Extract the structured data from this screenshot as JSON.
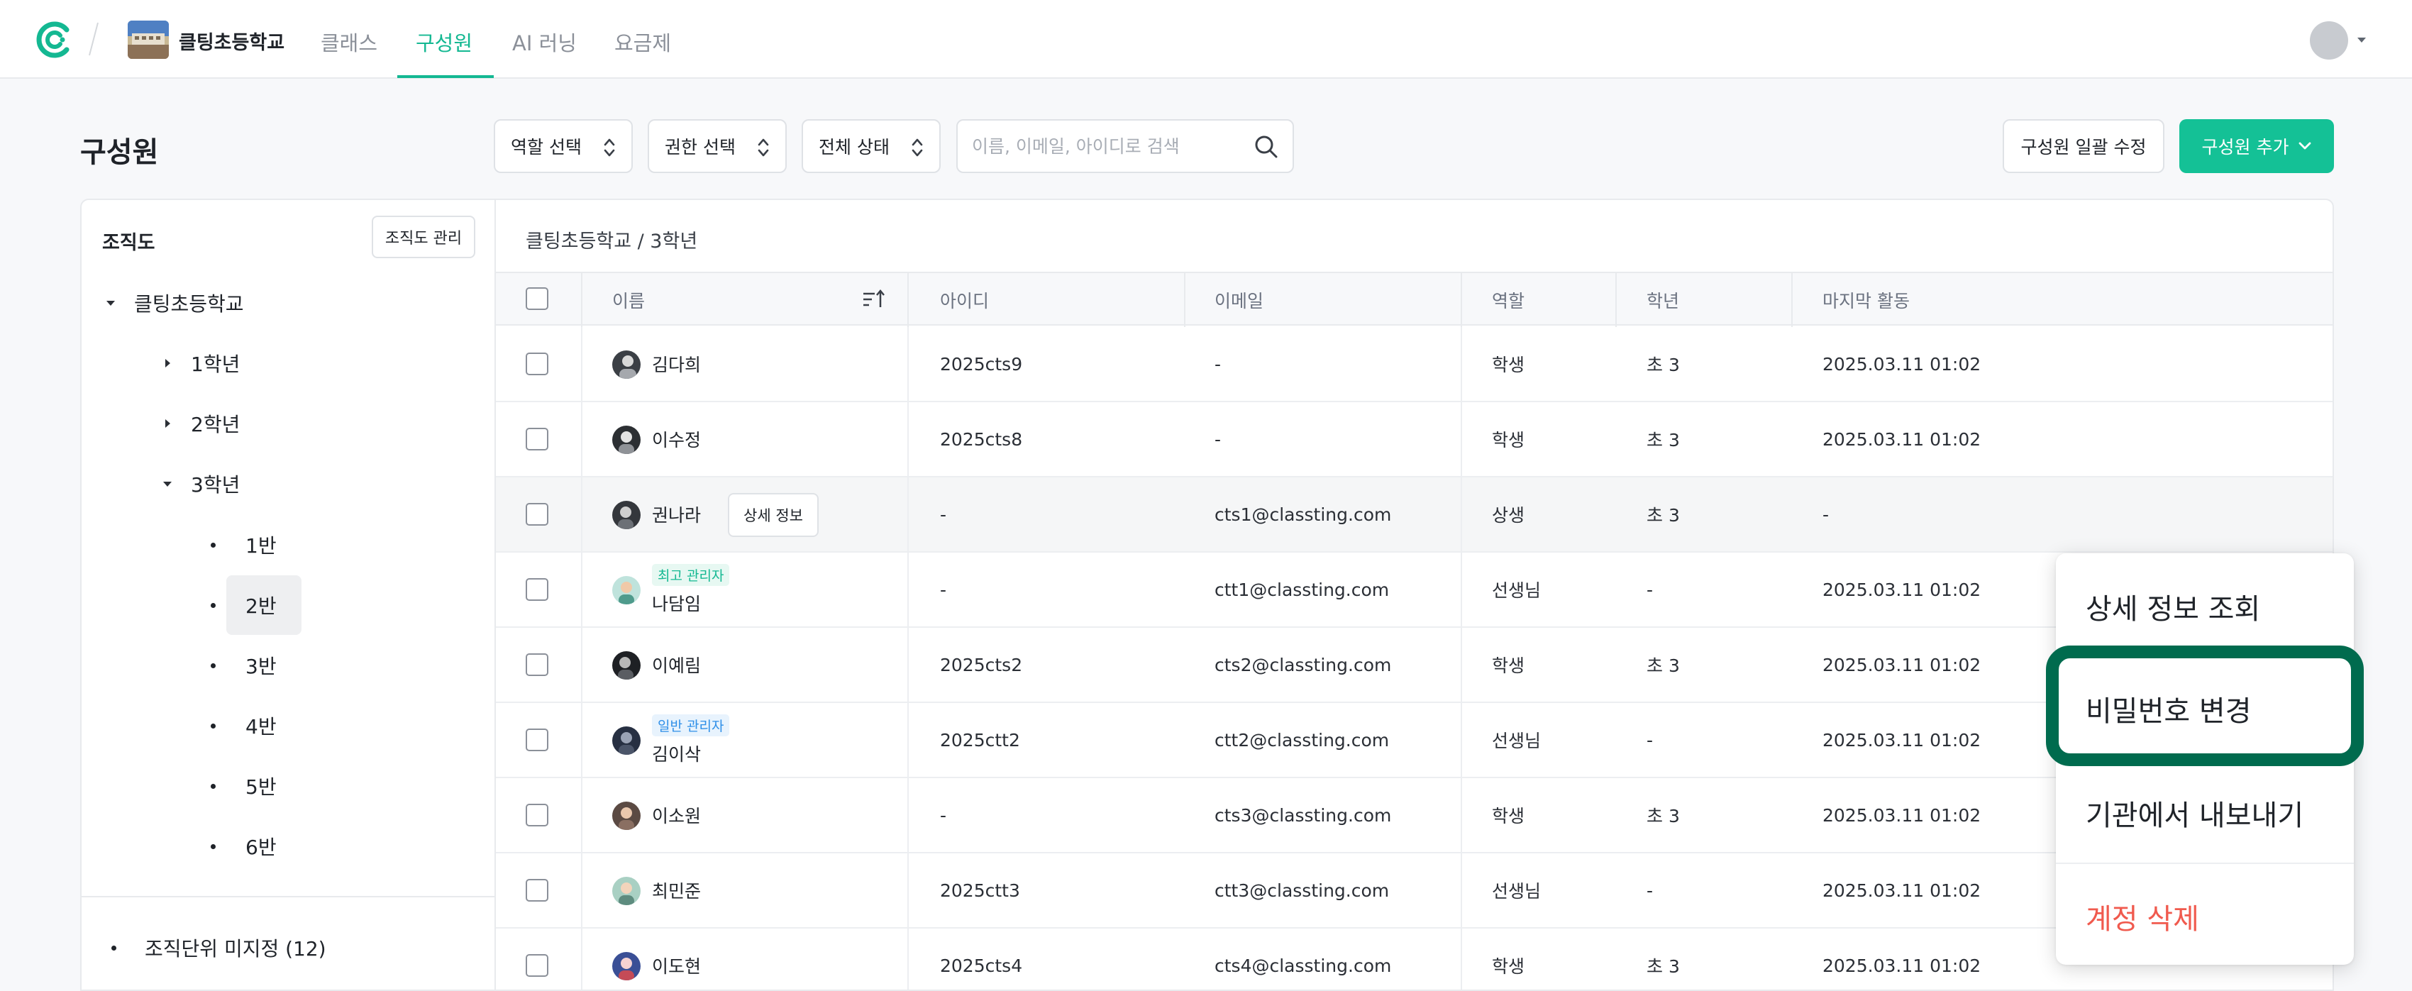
{
  "topbar": {
    "school_name": "클팅초등학교",
    "tabs": [
      {
        "label": "클래스",
        "active": false
      },
      {
        "label": "구성원",
        "active": true
      },
      {
        "label": "AI 러닝",
        "active": false
      },
      {
        "label": "요금제",
        "active": false
      }
    ],
    "icons": {
      "logo": "classting-logo-icon",
      "avatar": "user-avatar",
      "caret": "caret-down-icon"
    }
  },
  "page": {
    "title": "구성원"
  },
  "filters": {
    "role": "역할 선택",
    "permission": "권한 선택",
    "status": "전체 상태"
  },
  "search": {
    "placeholder": "이름, 이메일, 아이디로 검색",
    "value": ""
  },
  "actions": {
    "bulk_edit": "구성원 일괄 수정",
    "add_member": "구성원 추가"
  },
  "org_tree": {
    "title": "조직도",
    "manage_button": "조직도 관리",
    "root": "클팅초등학교",
    "grades": [
      "1학년",
      "2학년",
      "3학년"
    ],
    "classes": [
      "1반",
      "2반",
      "3반",
      "4반",
      "5반",
      "6반"
    ],
    "selected_class": "2반",
    "unassigned": "조직단위 미지정 (12)"
  },
  "table": {
    "breadcrumb": "클팅초등학교 / 3학년",
    "headers": {
      "name": "이름",
      "id": "아이디",
      "email": "이메일",
      "role": "역할",
      "grade": "학년",
      "last_active": "마지막 활동"
    },
    "detail_button": "상세 정보",
    "rows": [
      {
        "name": "김다희",
        "badge": "",
        "id": "2025cts9",
        "email": "-",
        "role": "학생",
        "grade": "초 3",
        "last_active": "2025.03.11 01:02"
      },
      {
        "name": "이수정",
        "badge": "",
        "id": "2025cts8",
        "email": "-",
        "role": "학생",
        "grade": "초 3",
        "last_active": "2025.03.11 01:02"
      },
      {
        "name": "권나라",
        "badge": "",
        "id": "-",
        "email": "cts1@classting.com",
        "role": "상생",
        "grade": "초 3",
        "last_active": "-"
      },
      {
        "name": "나담임",
        "badge": "최고 관리자",
        "id": "-",
        "email": "ctt1@classting.com",
        "role": "선생님",
        "grade": "-",
        "last_active": "2025.03.11 01:02"
      },
      {
        "name": "이예림",
        "badge": "",
        "id": "2025cts2",
        "email": "cts2@classting.com",
        "role": "학생",
        "grade": "초 3",
        "last_active": "2025.03.11 01:02"
      },
      {
        "name": "김이삭",
        "badge": "일반 관리자",
        "id": "2025ctt2",
        "email": "ctt2@classting.com",
        "role": "선생님",
        "grade": "-",
        "last_active": "2025.03.11 01:02"
      },
      {
        "name": "이소원",
        "badge": "",
        "id": "-",
        "email": "cts3@classting.com",
        "role": "학생",
        "grade": "초 3",
        "last_active": "2025.03.11 01:02"
      },
      {
        "name": "최민준",
        "badge": "",
        "id": "2025ctt3",
        "email": "ctt3@classting.com",
        "role": "선생님",
        "grade": "-",
        "last_active": "2025.03.11 01:02"
      },
      {
        "name": "이도현",
        "badge": "",
        "id": "2025cts4",
        "email": "cts4@classting.com",
        "role": "학생",
        "grade": "초 3",
        "last_active": "2025.03.11 01:02"
      }
    ]
  },
  "context_menu": {
    "items": [
      {
        "label": "상세 정보 조회",
        "danger": false
      },
      {
        "label": "비밀번호 변경",
        "danger": false,
        "highlighted": true
      },
      {
        "label": "기관에서 내보내기",
        "danger": false
      },
      {
        "label": "계정 삭제",
        "danger": true
      }
    ]
  },
  "colors": {
    "accent": "#14c196",
    "accent_text": "#14b892",
    "danger": "#f05a4e",
    "highlight_ring": "#006b4e",
    "badge_normal": "#2f8fe8"
  }
}
